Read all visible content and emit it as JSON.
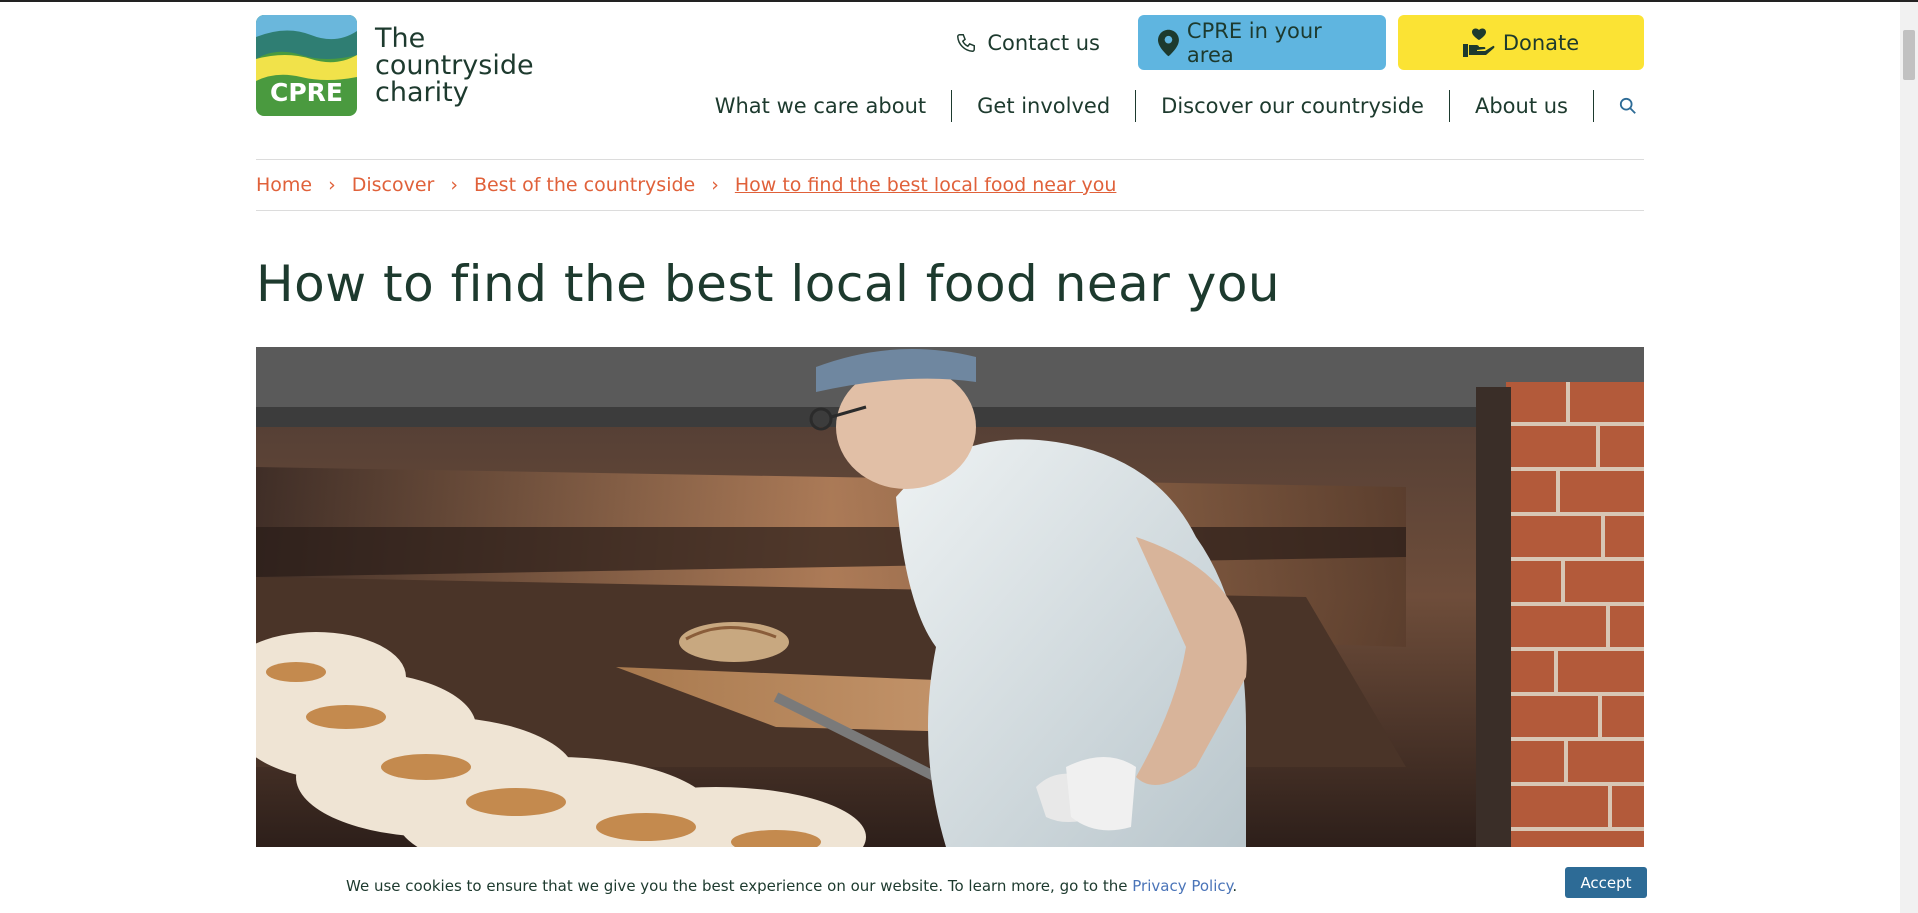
{
  "logo": {
    "mark_text": "CPRE",
    "lines": [
      "The",
      "countryside",
      "charity"
    ]
  },
  "header": {
    "contact_label": "Contact us",
    "area_label": "CPRE in your area",
    "donate_label": "Donate"
  },
  "nav": {
    "items": [
      "What we care about",
      "Get involved",
      "Discover our countryside",
      "About us"
    ]
  },
  "breadcrumb": {
    "items": [
      "Home",
      "Discover",
      "Best of the countryside",
      "How to find the best local food near you"
    ]
  },
  "page": {
    "title": "How to find the best local food near you"
  },
  "cookie": {
    "text": "We use cookies to ensure that we give you the best experience on our website. To learn more, go to the ",
    "link": "Privacy Policy",
    "suffix": ".",
    "accept_label": "Accept"
  },
  "colors": {
    "accent_orange": "#e0613a",
    "area_blue": "#5fb5e0",
    "donate_yellow": "#fbe334",
    "text_dark": "#1d3a2e",
    "accept_blue": "#2d6b96"
  }
}
